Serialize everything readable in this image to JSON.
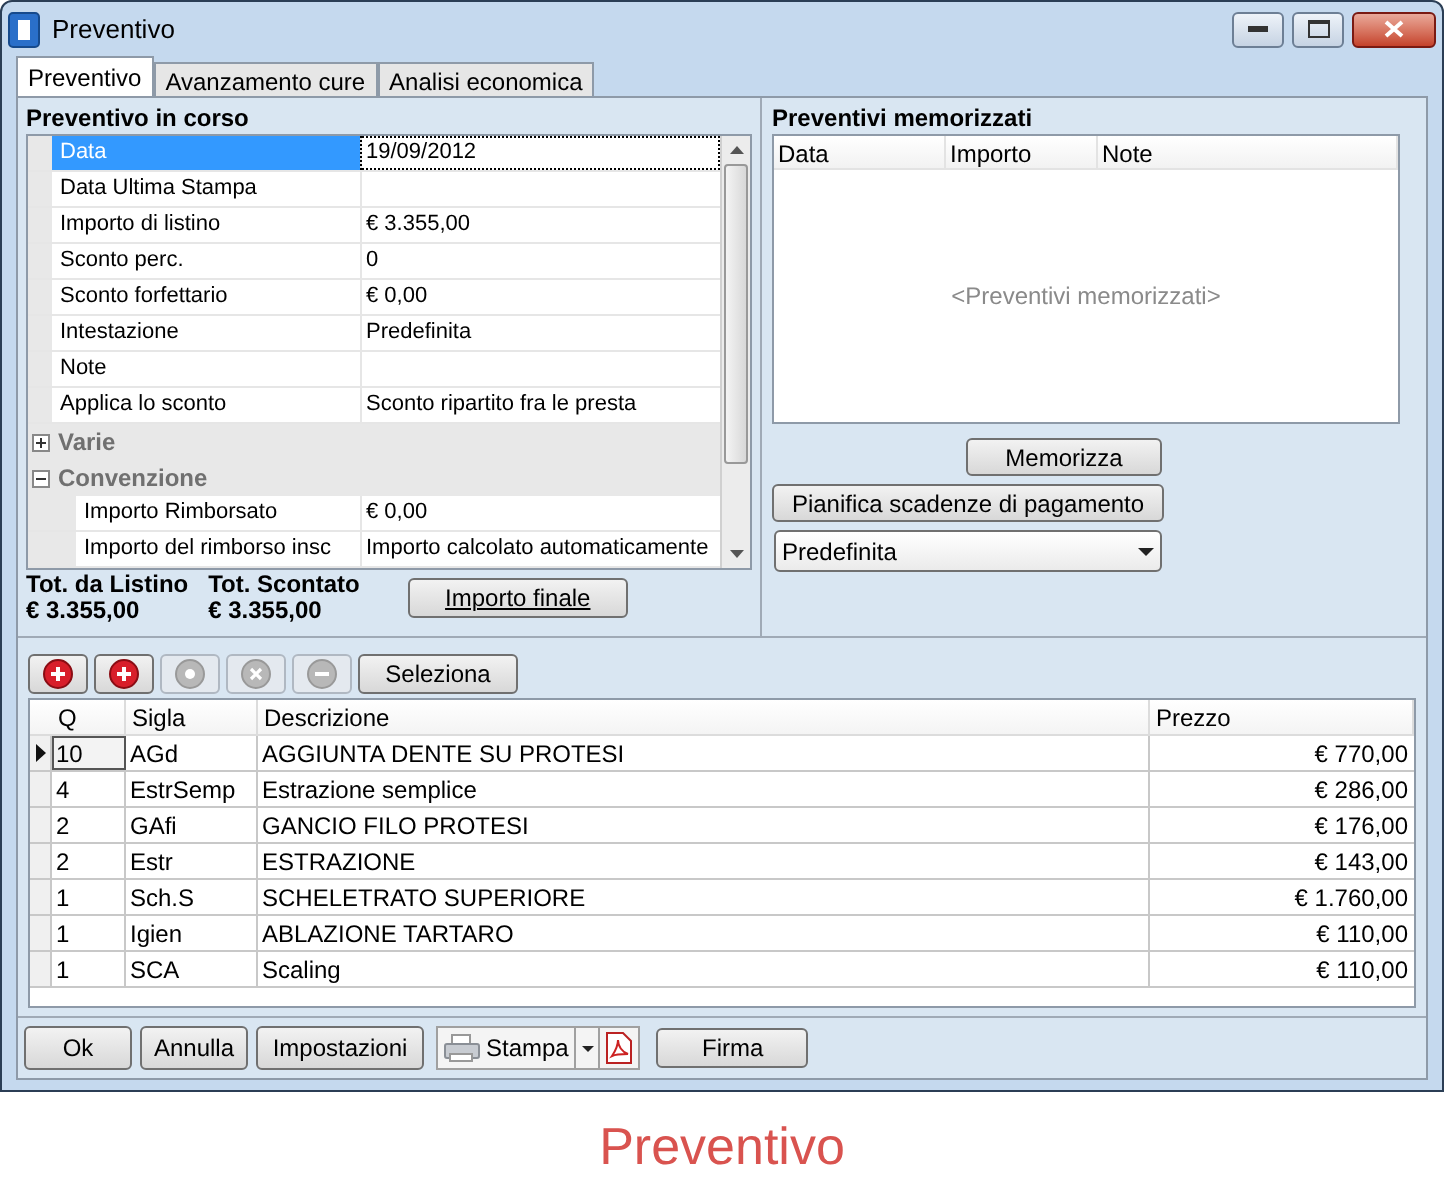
{
  "window": {
    "title": "Preventivo"
  },
  "tabs": [
    {
      "label": "Preventivo",
      "selected": true
    },
    {
      "label": "Avanzamento cure",
      "selected": false
    },
    {
      "label": "Analisi economica",
      "selected": false
    }
  ],
  "current": {
    "title": "Preventivo in corso",
    "properties": [
      {
        "label": "Data",
        "value": "19/09/2012",
        "selected": true
      },
      {
        "label": "Data Ultima Stampa",
        "selected": false
      },
      {
        "label": "Importo di listino",
        "value": "€ 3.355,00",
        "selected": false
      },
      {
        "label": "Sconto perc.",
        "value": "0",
        "selected": false
      },
      {
        "label": "Sconto forfettario",
        "value": "€ 0,00",
        "selected": false
      },
      {
        "label": "Intestazione",
        "value": "Predefinita",
        "selected": false
      },
      {
        "label": "Note",
        "selected": false
      },
      {
        "label": "Applica lo sconto",
        "value": "Sconto ripartito fra le presta",
        "selected": false
      }
    ],
    "groups": [
      {
        "label": "Varie",
        "expanded": false
      },
      {
        "label": "Convenzione",
        "expanded": true,
        "children": [
          {
            "label": "Importo Rimborsato",
            "value": "€ 0,00",
            "selected": false
          },
          {
            "label": "Importo del rimborso insc",
            "value": "Importo calcolato automaticamente",
            "selected": false
          }
        ]
      }
    ],
    "totals": [
      {
        "label": "Tot. da Listino",
        "value": "€ 3.355,00"
      },
      {
        "label": "Tot. Scontato",
        "value": "€ 3.355,00"
      }
    ],
    "button": "Importo finale"
  },
  "saved": {
    "title": "Preventivi memorizzati",
    "columns": [
      "Data",
      "Importo",
      "Note"
    ],
    "empty_text": "<Preventivi memorizzati>",
    "buttons": [
      "Memorizza",
      "Pianifica scadenze di pagamento"
    ],
    "dropdown": {
      "value": "Predefinita"
    }
  },
  "toolbar": {
    "icon_buttons": [
      {
        "kind": "add",
        "disabled": false
      },
      {
        "kind": "add",
        "disabled": false
      },
      {
        "kind": "edit",
        "disabled": true
      },
      {
        "kind": "delete",
        "disabled": true
      },
      {
        "kind": "remove",
        "disabled": true
      }
    ],
    "button": "Seleziona"
  },
  "table": {
    "columns": [
      "Q",
      "Sigla",
      "Descrizione",
      "Prezzo"
    ],
    "rows": [
      {
        "q": "10",
        "sigla": "AGd",
        "descrizione": "AGGIUNTA DENTE SU PROTESI",
        "prezzo": "€ 770,00",
        "selected": true
      },
      {
        "q": "4",
        "sigla": "EstrSemp",
        "descrizione": "Estrazione semplice",
        "prezzo": "€ 286,00",
        "selected": false
      },
      {
        "q": "2",
        "sigla": "GAfi",
        "descrizione": "GANCIO FILO PROTESI",
        "prezzo": "€ 176,00",
        "selected": false
      },
      {
        "q": "2",
        "sigla": "Estr",
        "descrizione": "ESTRAZIONE",
        "prezzo": "€ 143,00",
        "selected": false
      },
      {
        "q": "1",
        "sigla": "Sch.S",
        "descrizione": "SCHELETRATO SUPERIORE",
        "prezzo": "€ 1.760,00",
        "selected": false
      },
      {
        "q": "1",
        "sigla": "Igien",
        "descrizione": "ABLAZIONE TARTARO",
        "prezzo": "€ 110,00",
        "selected": false
      },
      {
        "q": "1",
        "sigla": "SCA",
        "descrizione": "Scaling",
        "prezzo": "€ 110,00",
        "selected": false
      }
    ]
  },
  "footer": {
    "buttons": [
      "Ok",
      "Annulla",
      "Impostazioni"
    ],
    "print_button": "Stampa",
    "sign_button": "Firma"
  },
  "caption": "Preventivo"
}
